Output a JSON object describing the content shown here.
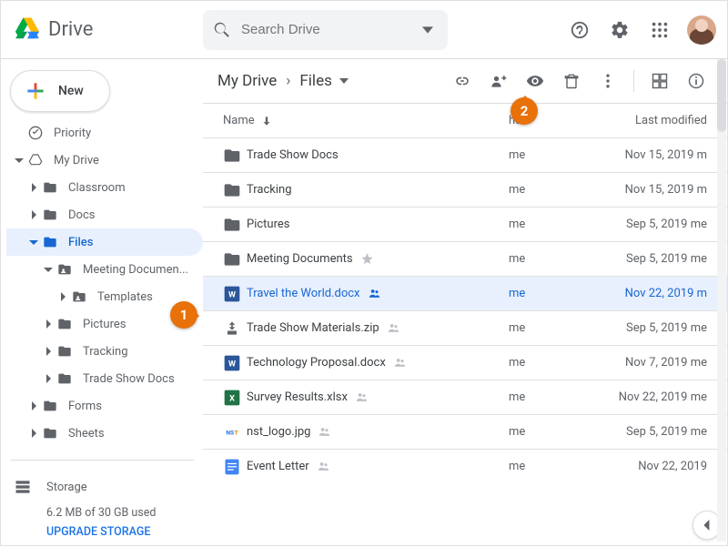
{
  "header": {
    "product": "Drive",
    "search_placeholder": "Search Drive"
  },
  "sidebar": {
    "new_label": "New",
    "priority": "Priority",
    "my_drive": "My Drive",
    "tree": [
      {
        "label": "Classroom",
        "level": 2,
        "shared": false
      },
      {
        "label": "Docs",
        "level": 2,
        "shared": false
      },
      {
        "label": "Files",
        "level": 2,
        "shared": false,
        "selected": true,
        "expanded": true
      },
      {
        "label": "Meeting Documen...",
        "level": 3,
        "shared": true,
        "expanded": true
      },
      {
        "label": "Templates",
        "level": 4,
        "shared": true
      },
      {
        "label": "Pictures",
        "level": 3,
        "shared": false
      },
      {
        "label": "Tracking",
        "level": 3,
        "shared": false
      },
      {
        "label": "Trade Show Docs",
        "level": 3,
        "shared": false
      },
      {
        "label": "Forms",
        "level": 2,
        "shared": false
      },
      {
        "label": "Sheets",
        "level": 2,
        "shared": false
      }
    ],
    "storage_label": "Storage",
    "storage_used": "6.2 MB of 30 GB used",
    "storage_upgrade": "UPGRADE STORAGE"
  },
  "main": {
    "breadcrumb": [
      "My Drive",
      "Files"
    ],
    "columns": {
      "name": "Name",
      "owner_partial": "her",
      "modified": "Last modified"
    },
    "files": [
      {
        "type": "folder",
        "name": "Trade Show Docs",
        "owner": "me",
        "modified": "Nov 15, 2019",
        "by": "m"
      },
      {
        "type": "folder",
        "name": "Tracking",
        "owner": "me",
        "modified": "Nov 15, 2019",
        "by": "m"
      },
      {
        "type": "folder",
        "name": "Pictures",
        "owner": "me",
        "modified": "Sep 5, 2019",
        "by": "me"
      },
      {
        "type": "folder",
        "name": "Meeting Documents",
        "owner": "me",
        "modified": "Sep 5, 2019",
        "by": "me",
        "starred": true
      },
      {
        "type": "word",
        "name": "Travel the World.docx",
        "owner": "me",
        "modified": "Nov 22, 2019",
        "by": "m",
        "selected": true,
        "shared": true
      },
      {
        "type": "zip",
        "name": "Trade Show Materials.zip",
        "owner": "me",
        "modified": "Sep 5, 2019",
        "by": "me",
        "shared": true
      },
      {
        "type": "word",
        "name": "Technology Proposal.docx",
        "owner": "me",
        "modified": "Nov 7, 2019",
        "by": "me",
        "shared": true
      },
      {
        "type": "xlsx",
        "name": "Survey Results.xlsx",
        "owner": "me",
        "modified": "Nov 22, 2019",
        "by": "me",
        "shared": true
      },
      {
        "type": "img",
        "name": "nst_logo.jpg",
        "owner": "me",
        "modified": "Sep 5, 2019",
        "by": "me",
        "shared": true
      },
      {
        "type": "gdoc",
        "name": "Event Letter",
        "owner": "me",
        "modified": "Nov 22, 2019",
        "shared": true
      }
    ]
  },
  "annotations": {
    "a1": "1",
    "a2": "2"
  }
}
